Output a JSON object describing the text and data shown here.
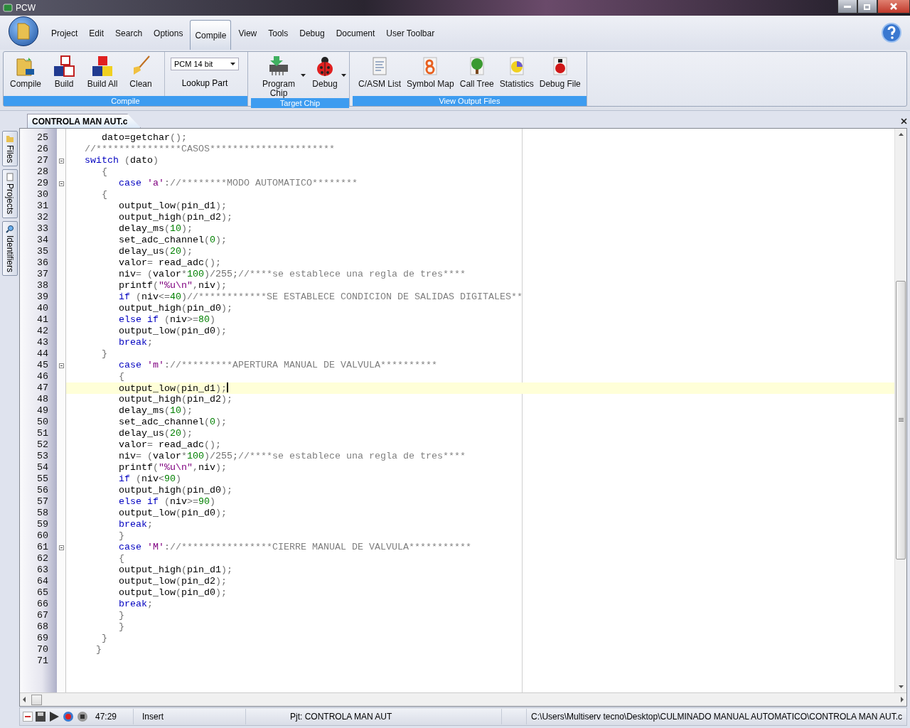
{
  "window": {
    "title": "PCW"
  },
  "menu": [
    {
      "label": "Project",
      "selected": false
    },
    {
      "label": "Edit",
      "selected": false
    },
    {
      "label": "Search",
      "selected": false
    },
    {
      "label": "Options",
      "selected": false
    },
    {
      "label": "Compile",
      "selected": true
    },
    {
      "label": "View",
      "selected": false
    },
    {
      "label": "Tools",
      "selected": false
    },
    {
      "label": "Debug",
      "selected": false
    },
    {
      "label": "Document",
      "selected": false
    },
    {
      "label": "User Toolbar",
      "selected": false
    }
  ],
  "ribbon": [
    {
      "title": "Compile",
      "items": [
        {
          "kind": "button",
          "label": "Compile"
        },
        {
          "kind": "button",
          "label": "Build"
        },
        {
          "kind": "button",
          "label": "Build All"
        },
        {
          "kind": "button",
          "label": "Clean"
        },
        {
          "kind": "select",
          "value": "PCM 14 bit",
          "label": "Lookup Part"
        }
      ]
    },
    {
      "title": "Target Chip",
      "items": [
        {
          "kind": "menu-button",
          "label": "Program Chip"
        },
        {
          "kind": "menu-button",
          "label": "Debug"
        }
      ]
    },
    {
      "title": "View Output Files",
      "items": [
        {
          "kind": "button",
          "label": "C/ASM List"
        },
        {
          "kind": "button",
          "label": "Symbol Map"
        },
        {
          "kind": "button",
          "label": "Call Tree"
        },
        {
          "kind": "button",
          "label": "Statistics"
        },
        {
          "kind": "button",
          "label": "Debug File"
        }
      ]
    }
  ],
  "document_tabs": [
    {
      "label": "CONTROLA MAN AUT.c",
      "selected": true
    }
  ],
  "side_tabs": [
    {
      "label": "Files"
    },
    {
      "label": "Projects"
    },
    {
      "label": "Identifiers"
    }
  ],
  "code_lines": [
    {
      "number": "25",
      "fold_marker": false,
      "current": false,
      "tokens": [
        {
          "kind": "plain",
          "text": "      dato=getchar"
        },
        {
          "kind": "op",
          "text": "();"
        }
      ]
    },
    {
      "number": "26",
      "fold_marker": false,
      "current": false,
      "tokens": [
        {
          "kind": "cm",
          "text": "   //***************CASOS**********************"
        }
      ]
    },
    {
      "number": "27",
      "fold_marker": true,
      "current": false,
      "tokens": [
        {
          "kind": "kw",
          "text": "   switch"
        },
        {
          "kind": "op",
          "text": " ("
        },
        {
          "kind": "plain",
          "text": "dato"
        },
        {
          "kind": "op",
          "text": ")"
        }
      ]
    },
    {
      "number": "28",
      "fold_marker": false,
      "current": false,
      "tokens": [
        {
          "kind": "op",
          "text": "      {"
        }
      ]
    },
    {
      "number": "29",
      "fold_marker": true,
      "current": false,
      "tokens": [
        {
          "kind": "kw",
          "text": "         case"
        },
        {
          "kind": "str",
          "text": " 'a'"
        },
        {
          "kind": "op",
          "text": ":"
        },
        {
          "kind": "cm",
          "text": "//********MODO AUTOMATICO********"
        }
      ]
    },
    {
      "number": "30",
      "fold_marker": false,
      "current": false,
      "tokens": [
        {
          "kind": "op",
          "text": "      {"
        }
      ]
    },
    {
      "number": "31",
      "fold_marker": false,
      "current": false,
      "tokens": [
        {
          "kind": "plain",
          "text": "         output_low"
        },
        {
          "kind": "op",
          "text": "("
        },
        {
          "kind": "plain",
          "text": "pin_d1"
        },
        {
          "kind": "op",
          "text": ");"
        }
      ]
    },
    {
      "number": "32",
      "fold_marker": false,
      "current": false,
      "tokens": [
        {
          "kind": "plain",
          "text": "         output_high"
        },
        {
          "kind": "op",
          "text": "("
        },
        {
          "kind": "plain",
          "text": "pin_d2"
        },
        {
          "kind": "op",
          "text": ");"
        }
      ]
    },
    {
      "number": "33",
      "fold_marker": false,
      "current": false,
      "tokens": [
        {
          "kind": "plain",
          "text": "         delay_ms"
        },
        {
          "kind": "op",
          "text": "("
        },
        {
          "kind": "num",
          "text": "10"
        },
        {
          "kind": "op",
          "text": ");"
        }
      ]
    },
    {
      "number": "34",
      "fold_marker": false,
      "current": false,
      "tokens": [
        {
          "kind": "plain",
          "text": "         set_adc_channel"
        },
        {
          "kind": "op",
          "text": "("
        },
        {
          "kind": "num",
          "text": "0"
        },
        {
          "kind": "op",
          "text": ");"
        }
      ]
    },
    {
      "number": "35",
      "fold_marker": false,
      "current": false,
      "tokens": [
        {
          "kind": "plain",
          "text": "         delay_us"
        },
        {
          "kind": "op",
          "text": "("
        },
        {
          "kind": "num",
          "text": "20"
        },
        {
          "kind": "op",
          "text": ");"
        }
      ]
    },
    {
      "number": "36",
      "fold_marker": false,
      "current": false,
      "tokens": [
        {
          "kind": "plain",
          "text": "         valor"
        },
        {
          "kind": "op",
          "text": "= "
        },
        {
          "kind": "plain",
          "text": "read_adc"
        },
        {
          "kind": "op",
          "text": "();"
        }
      ]
    },
    {
      "number": "37",
      "fold_marker": false,
      "current": false,
      "tokens": [
        {
          "kind": "plain",
          "text": "         niv"
        },
        {
          "kind": "op",
          "text": "= ("
        },
        {
          "kind": "plain",
          "text": "valor"
        },
        {
          "kind": "op",
          "text": "*"
        },
        {
          "kind": "num",
          "text": "100"
        },
        {
          "kind": "op",
          "text": ")/255;"
        },
        {
          "kind": "cm",
          "text": "//****se establece una regla de tres****"
        }
      ]
    },
    {
      "number": "38",
      "fold_marker": false,
      "current": false,
      "tokens": [
        {
          "kind": "plain",
          "text": "         printf"
        },
        {
          "kind": "op",
          "text": "("
        },
        {
          "kind": "str",
          "text": "\"%u\\n\""
        },
        {
          "kind": "op",
          "text": ","
        },
        {
          "kind": "plain",
          "text": "niv"
        },
        {
          "kind": "op",
          "text": ");"
        }
      ]
    },
    {
      "number": "39",
      "fold_marker": false,
      "current": false,
      "tokens": [
        {
          "kind": "kw",
          "text": "         if"
        },
        {
          "kind": "op",
          "text": " ("
        },
        {
          "kind": "plain",
          "text": "niv"
        },
        {
          "kind": "op",
          "text": "<="
        },
        {
          "kind": "num",
          "text": "40"
        },
        {
          "kind": "op",
          "text": ")"
        },
        {
          "kind": "cm",
          "text": "//************SE ESTABLECE CONDICION DE SALIDAS DIGITALES**"
        }
      ]
    },
    {
      "number": "40",
      "fold_marker": false,
      "current": false,
      "tokens": [
        {
          "kind": "plain",
          "text": "         output_high"
        },
        {
          "kind": "op",
          "text": "("
        },
        {
          "kind": "plain",
          "text": "pin_d0"
        },
        {
          "kind": "op",
          "text": ");"
        }
      ]
    },
    {
      "number": "41",
      "fold_marker": false,
      "current": false,
      "tokens": [
        {
          "kind": "kw",
          "text": "         else if"
        },
        {
          "kind": "op",
          "text": " ("
        },
        {
          "kind": "plain",
          "text": "niv"
        },
        {
          "kind": "op",
          "text": ">="
        },
        {
          "kind": "num",
          "text": "80"
        },
        {
          "kind": "op",
          "text": ")"
        }
      ]
    },
    {
      "number": "42",
      "fold_marker": false,
      "current": false,
      "tokens": [
        {
          "kind": "plain",
          "text": "         output_low"
        },
        {
          "kind": "op",
          "text": "("
        },
        {
          "kind": "plain",
          "text": "pin_d0"
        },
        {
          "kind": "op",
          "text": ");"
        }
      ]
    },
    {
      "number": "43",
      "fold_marker": false,
      "current": false,
      "tokens": [
        {
          "kind": "kw",
          "text": "         break"
        },
        {
          "kind": "op",
          "text": ";"
        }
      ]
    },
    {
      "number": "44",
      "fold_marker": false,
      "current": false,
      "tokens": [
        {
          "kind": "op",
          "text": "      }"
        }
      ]
    },
    {
      "number": "45",
      "fold_marker": true,
      "current": false,
      "tokens": [
        {
          "kind": "kw",
          "text": "         case"
        },
        {
          "kind": "str",
          "text": " 'm'"
        },
        {
          "kind": "op",
          "text": ":"
        },
        {
          "kind": "cm",
          "text": "//*********APERTURA MANUAL DE VALVULA**********"
        }
      ]
    },
    {
      "number": "46",
      "fold_marker": false,
      "current": false,
      "tokens": [
        {
          "kind": "op",
          "text": "         {"
        }
      ]
    },
    {
      "number": "47",
      "fold_marker": false,
      "current": true,
      "tokens": [
        {
          "kind": "plain",
          "text": "         output_low"
        },
        {
          "kind": "op",
          "text": "("
        },
        {
          "kind": "plain",
          "text": "pin_d1"
        },
        {
          "kind": "op",
          "text": ");"
        }
      ]
    },
    {
      "number": "48",
      "fold_marker": false,
      "current": false,
      "tokens": [
        {
          "kind": "plain",
          "text": "         output_high"
        },
        {
          "kind": "op",
          "text": "("
        },
        {
          "kind": "plain",
          "text": "pin_d2"
        },
        {
          "kind": "op",
          "text": ");"
        }
      ]
    },
    {
      "number": "49",
      "fold_marker": false,
      "current": false,
      "tokens": [
        {
          "kind": "plain",
          "text": "         delay_ms"
        },
        {
          "kind": "op",
          "text": "("
        },
        {
          "kind": "num",
          "text": "10"
        },
        {
          "kind": "op",
          "text": ");"
        }
      ]
    },
    {
      "number": "50",
      "fold_marker": false,
      "current": false,
      "tokens": [
        {
          "kind": "plain",
          "text": "         set_adc_channel"
        },
        {
          "kind": "op",
          "text": "("
        },
        {
          "kind": "num",
          "text": "0"
        },
        {
          "kind": "op",
          "text": ");"
        }
      ]
    },
    {
      "number": "51",
      "fold_marker": false,
      "current": false,
      "tokens": [
        {
          "kind": "plain",
          "text": "         delay_us"
        },
        {
          "kind": "op",
          "text": "("
        },
        {
          "kind": "num",
          "text": "20"
        },
        {
          "kind": "op",
          "text": ");"
        }
      ]
    },
    {
      "number": "52",
      "fold_marker": false,
      "current": false,
      "tokens": [
        {
          "kind": "plain",
          "text": "         valor"
        },
        {
          "kind": "op",
          "text": "= "
        },
        {
          "kind": "plain",
          "text": "read_adc"
        },
        {
          "kind": "op",
          "text": "();"
        }
      ]
    },
    {
      "number": "53",
      "fold_marker": false,
      "current": false,
      "tokens": [
        {
          "kind": "plain",
          "text": "         niv"
        },
        {
          "kind": "op",
          "text": "= ("
        },
        {
          "kind": "plain",
          "text": "valor"
        },
        {
          "kind": "op",
          "text": "*"
        },
        {
          "kind": "num",
          "text": "100"
        },
        {
          "kind": "op",
          "text": ")/255;"
        },
        {
          "kind": "cm",
          "text": "//****se establece una regla de tres****"
        }
      ]
    },
    {
      "number": "54",
      "fold_marker": false,
      "current": false,
      "tokens": [
        {
          "kind": "plain",
          "text": "         printf"
        },
        {
          "kind": "op",
          "text": "("
        },
        {
          "kind": "str",
          "text": "\"%u\\n\""
        },
        {
          "kind": "op",
          "text": ","
        },
        {
          "kind": "plain",
          "text": "niv"
        },
        {
          "kind": "op",
          "text": ");"
        }
      ]
    },
    {
      "number": "55",
      "fold_marker": false,
      "current": false,
      "tokens": [
        {
          "kind": "kw",
          "text": "         if"
        },
        {
          "kind": "op",
          "text": " ("
        },
        {
          "kind": "plain",
          "text": "niv"
        },
        {
          "kind": "op",
          "text": "<"
        },
        {
          "kind": "num",
          "text": "90"
        },
        {
          "kind": "op",
          "text": ")"
        }
      ]
    },
    {
      "number": "56",
      "fold_marker": false,
      "current": false,
      "tokens": [
        {
          "kind": "plain",
          "text": "         output_high"
        },
        {
          "kind": "op",
          "text": "("
        },
        {
          "kind": "plain",
          "text": "pin_d0"
        },
        {
          "kind": "op",
          "text": ");"
        }
      ]
    },
    {
      "number": "57",
      "fold_marker": false,
      "current": false,
      "tokens": [
        {
          "kind": "kw",
          "text": "         else if"
        },
        {
          "kind": "op",
          "text": " ("
        },
        {
          "kind": "plain",
          "text": "niv"
        },
        {
          "kind": "op",
          "text": ">="
        },
        {
          "kind": "num",
          "text": "90"
        },
        {
          "kind": "op",
          "text": ")"
        }
      ]
    },
    {
      "number": "58",
      "fold_marker": false,
      "current": false,
      "tokens": [
        {
          "kind": "plain",
          "text": "         output_low"
        },
        {
          "kind": "op",
          "text": "("
        },
        {
          "kind": "plain",
          "text": "pin_d0"
        },
        {
          "kind": "op",
          "text": ");"
        }
      ]
    },
    {
      "number": "59",
      "fold_marker": false,
      "current": false,
      "tokens": [
        {
          "kind": "kw",
          "text": "         break"
        },
        {
          "kind": "op",
          "text": ";"
        }
      ]
    },
    {
      "number": "60",
      "fold_marker": false,
      "current": false,
      "tokens": [
        {
          "kind": "op",
          "text": "         }"
        }
      ]
    },
    {
      "number": "61",
      "fold_marker": true,
      "current": false,
      "tokens": [
        {
          "kind": "kw",
          "text": "         case"
        },
        {
          "kind": "str",
          "text": " 'M'"
        },
        {
          "kind": "op",
          "text": ":"
        },
        {
          "kind": "cm",
          "text": "//****************CIERRE MANUAL DE VALVULA***********"
        }
      ]
    },
    {
      "number": "62",
      "fold_marker": false,
      "current": false,
      "tokens": [
        {
          "kind": "op",
          "text": "         {"
        }
      ]
    },
    {
      "number": "63",
      "fold_marker": false,
      "current": false,
      "tokens": [
        {
          "kind": "plain",
          "text": "         output_high"
        },
        {
          "kind": "op",
          "text": "("
        },
        {
          "kind": "plain",
          "text": "pin_d1"
        },
        {
          "kind": "op",
          "text": ");"
        }
      ]
    },
    {
      "number": "64",
      "fold_marker": false,
      "current": false,
      "tokens": [
        {
          "kind": "plain",
          "text": "         output_low"
        },
        {
          "kind": "op",
          "text": "("
        },
        {
          "kind": "plain",
          "text": "pin_d2"
        },
        {
          "kind": "op",
          "text": ");"
        }
      ]
    },
    {
      "number": "65",
      "fold_marker": false,
      "current": false,
      "tokens": [
        {
          "kind": "plain",
          "text": "         output_low"
        },
        {
          "kind": "op",
          "text": "("
        },
        {
          "kind": "plain",
          "text": "pin_d0"
        },
        {
          "kind": "op",
          "text": ");"
        }
      ]
    },
    {
      "number": "66",
      "fold_marker": false,
      "current": false,
      "tokens": [
        {
          "kind": "kw",
          "text": "         break"
        },
        {
          "kind": "op",
          "text": ";"
        }
      ]
    },
    {
      "number": "67",
      "fold_marker": false,
      "current": false,
      "tokens": [
        {
          "kind": "op",
          "text": "         }"
        }
      ]
    },
    {
      "number": "68",
      "fold_marker": false,
      "current": false,
      "tokens": [
        {
          "kind": "op",
          "text": "         }"
        }
      ]
    },
    {
      "number": "69",
      "fold_marker": false,
      "current": false,
      "tokens": [
        {
          "kind": "op",
          "text": "      }"
        }
      ]
    },
    {
      "number": "70",
      "fold_marker": false,
      "current": false,
      "tokens": [
        {
          "kind": "op",
          "text": "     }"
        }
      ]
    },
    {
      "number": "71",
      "fold_marker": false,
      "current": false
    }
  ],
  "status_bar": {
    "position": "47:29",
    "mode": "Insert",
    "project": "Pjt: CONTROLA MAN AUT",
    "path": "C:\\Users\\Multiserv tecno\\Desktop\\CULMINADO MANUAL AUTOMATICO\\CONTROLA MAN AUT.c"
  }
}
